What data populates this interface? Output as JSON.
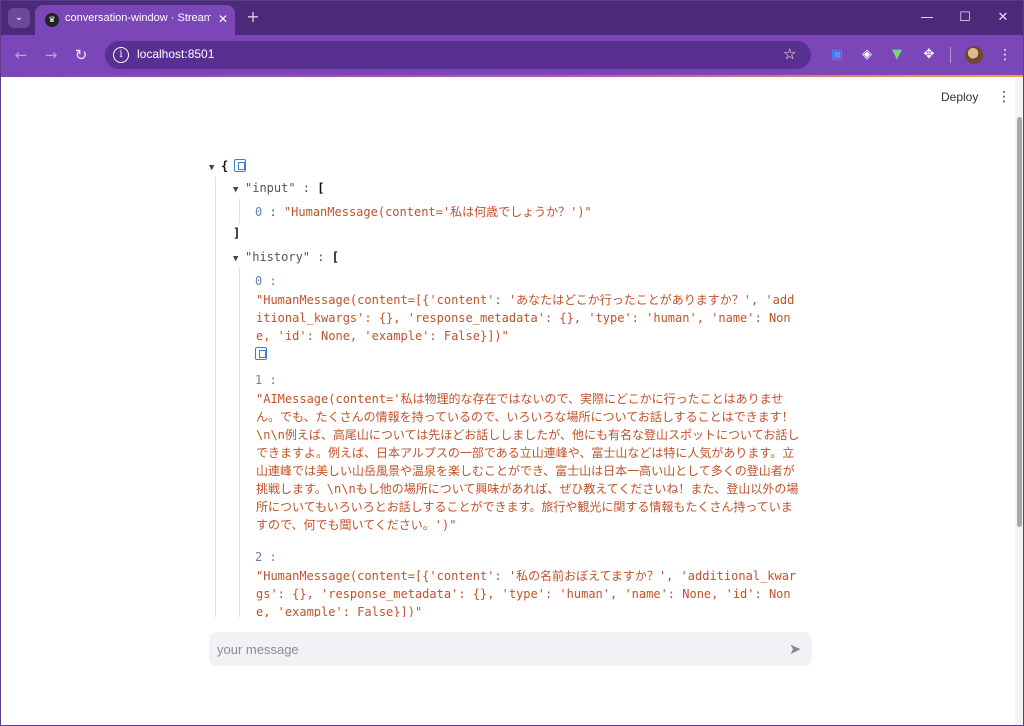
{
  "browser": {
    "tab_title": "conversation-window · Streaml",
    "tab_close": "✕",
    "new_tab": "+",
    "url": "localhost:8501",
    "window_controls": {
      "minimize": "—",
      "maximize": "☐",
      "close": "✕"
    }
  },
  "app": {
    "deploy_label": "Deploy",
    "menu_icon": "⋮",
    "json": {
      "open_brace": "{",
      "input_key": "\"input\"",
      "input_items": [
        {
          "index": "0",
          "value": "\"HumanMessage(content='私は何歳でしょうか？')\""
        }
      ],
      "history_key": "\"history\"",
      "history_items": [
        {
          "index": "0 :",
          "value": "\"HumanMessage(content=[{'content': 'あなたはどこか行ったことがありますか？', 'additional_kwargs': {}, 'response_metadata': {}, 'type': 'human', 'name': None, 'id': None, 'example': False}])\""
        },
        {
          "index": "1 :",
          "value": "\"AIMessage(content='私は物理的な存在ではないので、実際にどこかに行ったことはありません。でも、たくさんの情報を持っているので、いろいろな場所についてお話しすることはできます！\\n\\n例えば、高尾山については先ほどお話ししましたが、他にも有名な登山スポットについてお話しできますよ。例えば、日本アルプスの一部である立山連峰や、富士山などは特に人気があります。立山連峰では美しい山岳風景や温泉を楽しむことができ、富士山は日本一高い山として多くの登山者が挑戦します。\\n\\nもし他の場所について興味があれば、ぜひ教えてくださいね！また、登山以外の場所についてもいろいろとお話しすることができます。旅行や観光に関する情報もたくさん持っていますので、何でも聞いてください。')\""
        },
        {
          "index": "2 :",
          "value": "\"HumanMessage(content=[{'content': '私の名前おぼえてますか？', 'additional_kwargs': {}, 'response_metadata': {}, 'type': 'human', 'name': None, 'id': None, 'example': False}])\""
        }
      ]
    },
    "chat": {
      "placeholder": "your message",
      "value": ""
    }
  }
}
